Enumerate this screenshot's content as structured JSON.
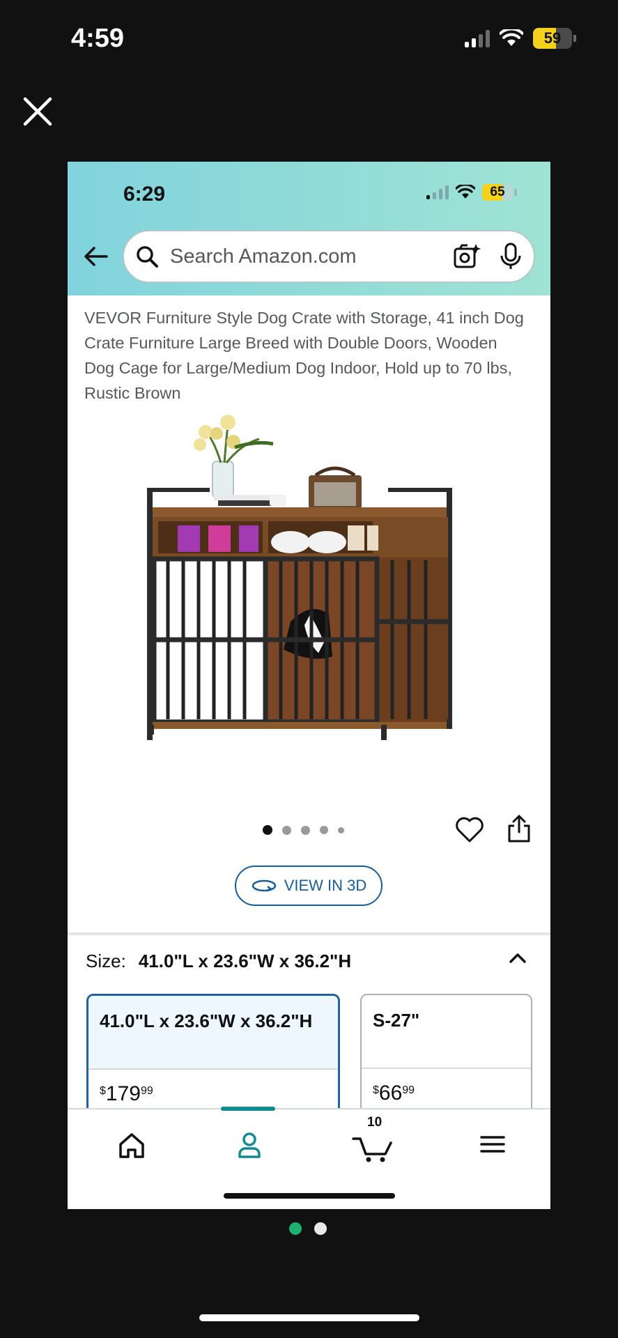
{
  "outer_status": {
    "time": "4:59",
    "battery": "59",
    "battery_level": 0.59
  },
  "inner_status": {
    "time": "6:29",
    "battery": "65",
    "battery_level": 0.65
  },
  "search": {
    "placeholder": "Search Amazon.com"
  },
  "product": {
    "title": "VEVOR Furniture Style Dog Crate with Storage, 41 inch Dog Crate Furniture Large Breed with Double Doors, Wooden Dog Cage for Large/Medium Dog Indoor, Hold up to 70 lbs, Rustic Brown"
  },
  "image_carousel": {
    "total": 5,
    "active": 1
  },
  "view3d": {
    "label": "VIEW IN 3D"
  },
  "size": {
    "label": "Size:",
    "selected": "41.0\"L x 23.6\"W x 36.2\"H",
    "options": [
      {
        "name": "41.0\"L x 23.6\"W x 36.2\"H",
        "currency": "$",
        "price_whole": "179",
        "price_cents": "99",
        "selected": true
      },
      {
        "name": "S-27\"",
        "currency": "$",
        "price_whole": "66",
        "price_cents": "99",
        "selected": false
      }
    ]
  },
  "nav": {
    "items": [
      "home-icon",
      "account-icon",
      "cart-icon",
      "menu-icon"
    ],
    "active": "account",
    "cart_count": "10"
  },
  "pager": {
    "total": 2,
    "active": 1
  },
  "colors": {
    "header_gradient_start": "#81d3dd",
    "header_gradient_end": "#9fe3d4",
    "accent_teal": "#138a8f",
    "link_blue": "#1a5c95",
    "selected_border": "#2162a1",
    "battery_yellow": "#f4d21c",
    "pager_active": "#1db36f"
  }
}
